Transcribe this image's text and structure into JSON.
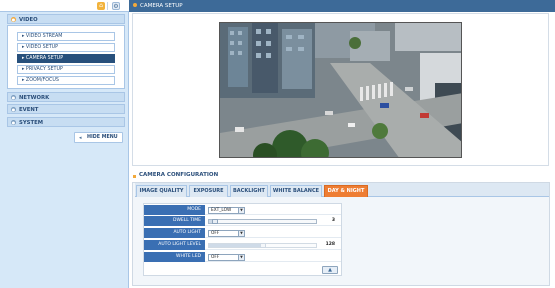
{
  "toolbar": {
    "home_icon": "home-icon",
    "settings_icon": "gear-icon"
  },
  "sidebar": {
    "sections": [
      {
        "label": "VIDEO",
        "expanded": true
      },
      {
        "label": "NETWORK",
        "expanded": false
      },
      {
        "label": "EVENT",
        "expanded": false
      },
      {
        "label": "SYSTEM",
        "expanded": false
      }
    ],
    "video_items": [
      {
        "label": "▸ VIDEO STREAM",
        "active": false
      },
      {
        "label": "▸ VIDEO SETUP",
        "active": false
      },
      {
        "label": "▸ CAMERA SETUP",
        "active": true
      },
      {
        "label": "▸ PRIVACY SETUP",
        "active": false
      },
      {
        "label": "▸ ZOOM/FOCUS",
        "active": false
      }
    ],
    "hide_menu_label": "HIDE MENU"
  },
  "header": {
    "title": "CAMERA SETUP"
  },
  "config": {
    "title": "CAMERA CONFIGURATION",
    "tabs": [
      {
        "label": "IMAGE QUALITY",
        "active": false
      },
      {
        "label": "EXPOSURE",
        "active": false
      },
      {
        "label": "BACKLIGHT",
        "active": false
      },
      {
        "label": "WHITE BALANCE",
        "active": false
      },
      {
        "label": "DAY & NIGHT",
        "active": true
      }
    ],
    "fields": {
      "mode": {
        "label": "MODE",
        "value": "EXT_LOW"
      },
      "dwell_time": {
        "label": "DWELL TIME",
        "value": "3",
        "level": 0.03
      },
      "auto_light": {
        "label": "AUTO LIGHT",
        "value": "OFF"
      },
      "auto_light_level": {
        "label": "AUTO LIGHT LEVEL",
        "value": "128",
        "level": 0.5
      },
      "white_led": {
        "label": "WHITE LED",
        "value": "OFF"
      }
    },
    "apply_icon": "apply-icon"
  },
  "colors": {
    "header_bar": "#3d6a98",
    "active_tab": "#ee7d33",
    "active_menu": "#27507c",
    "field_label_bg": "#3a6fb3",
    "sidebar_bg": "#d6e8f8"
  }
}
